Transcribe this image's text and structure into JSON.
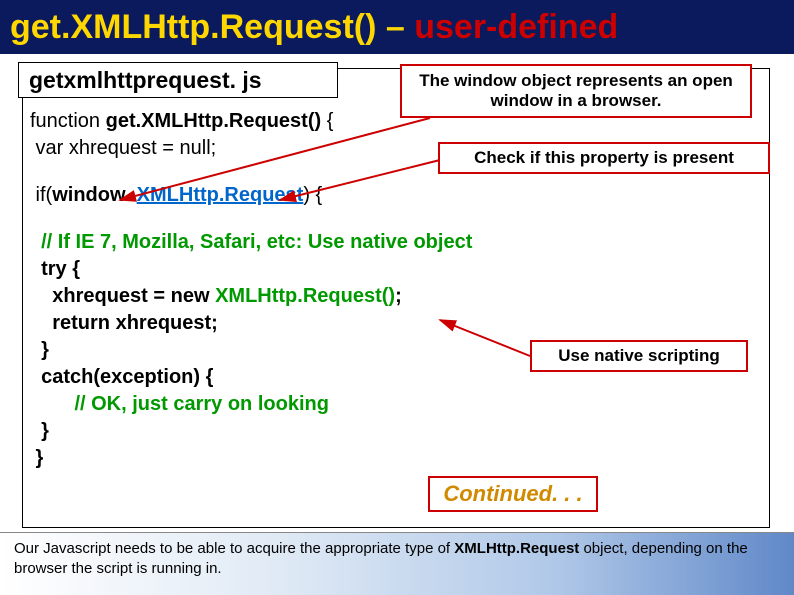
{
  "title": {
    "part1": "get.XMLHttp.Request()",
    "dash": " – ",
    "part2": "user-defined"
  },
  "filename": "getxmlhttprequest. js",
  "code": {
    "l1a": "function ",
    "l1b": "get.XMLHttp.Request()",
    "l1c": " {",
    "l2": " var xhrequest = null;",
    "l3a": " if(",
    "l3b": "window",
    "l3c": ". ",
    "l3d": "XMLHttp.Request",
    "l3e": ") {",
    "l4": "  // If IE 7, Mozilla, Safari, etc: Use native object",
    "l5": "  try {",
    "l6a": "    xhrequest = ",
    "l6b": "new",
    "l6c": " ",
    "l6d": "XMLHttp.Request()",
    "l6e": ";",
    "l7": "    return xhrequest;",
    "l8": "  }",
    "l9": "  catch(exception) {",
    "l10": "        // OK, just carry on looking",
    "l11": "  }",
    "l12": " }"
  },
  "callout1": "The window object represents an open window in a browser.",
  "callout2": "Check if this property is present",
  "callout3": "Use native scripting",
  "continued": "Continued. . .",
  "footer": {
    "a": "Our Javascript needs to be able to acquire the appropriate type of ",
    "b": "XMLHttp.Request",
    "c": " object, depending on the browser the script is running in."
  }
}
